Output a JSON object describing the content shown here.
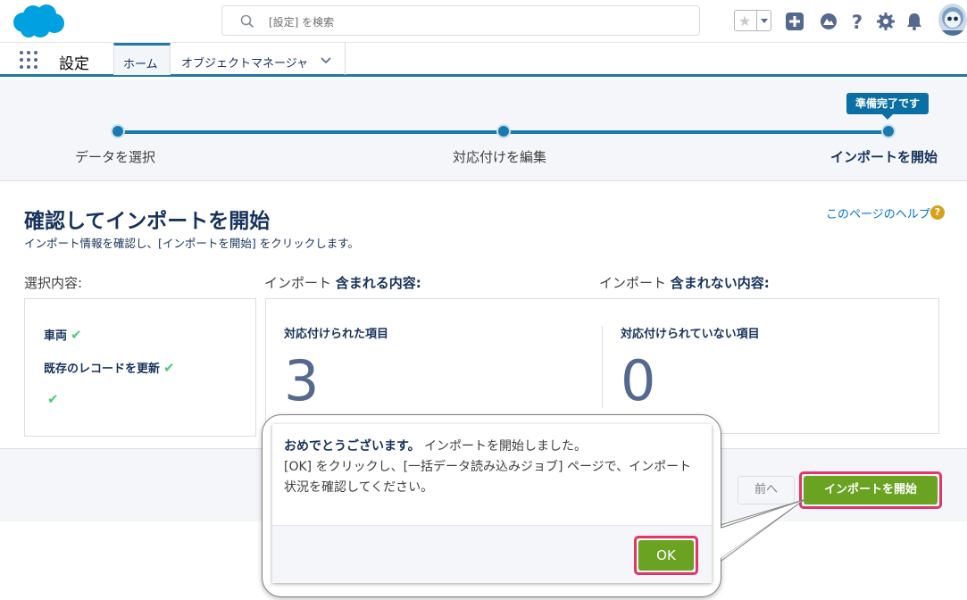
{
  "header": {
    "search_placeholder": "[設定] を検索"
  },
  "context": {
    "app_name": "設定",
    "tabs": [
      {
        "label": "ホーム"
      },
      {
        "label": "オブジェクトマネージャ"
      }
    ]
  },
  "path": {
    "badge": "準備完了です",
    "steps": [
      {
        "label": "データを選択"
      },
      {
        "label": "対応付けを編集"
      },
      {
        "label": "インポートを開始"
      }
    ]
  },
  "main": {
    "title": "確認してインポートを開始",
    "subtitle": "インポート情報を確認し、[インポートを開始] をクリックします。",
    "help_link": "このページのヘルプ",
    "selected_heading": "選択内容:",
    "included_heading_prefix": "インポート ",
    "included_heading_bold": "含まれる内容:",
    "excluded_heading_prefix": "インポート ",
    "excluded_heading_bold": "含まれない内容:",
    "selected_items": [
      "車両",
      "既存のレコードを更新",
      ""
    ],
    "mapped_label": "対応付けられた項目",
    "mapped_count": "3",
    "unmapped_label": "対応付けられていない項目",
    "unmapped_count": "0"
  },
  "footer": {
    "prev_label": "前へ",
    "start_label": "インポートを開始"
  },
  "callout": {
    "bold": "おめでとうございます。",
    "line1": " インポートを開始しました。",
    "line2": "[OK] をクリックし、[一括データ読み込みジョブ] ページで、インポート状況を確認してください。",
    "ok_label": "OK"
  },
  "colors": {
    "brand_blue": "#1a7ab0",
    "button_green": "#6aa221",
    "highlight_pink": "#e4356a",
    "check_green": "#4bca81"
  }
}
